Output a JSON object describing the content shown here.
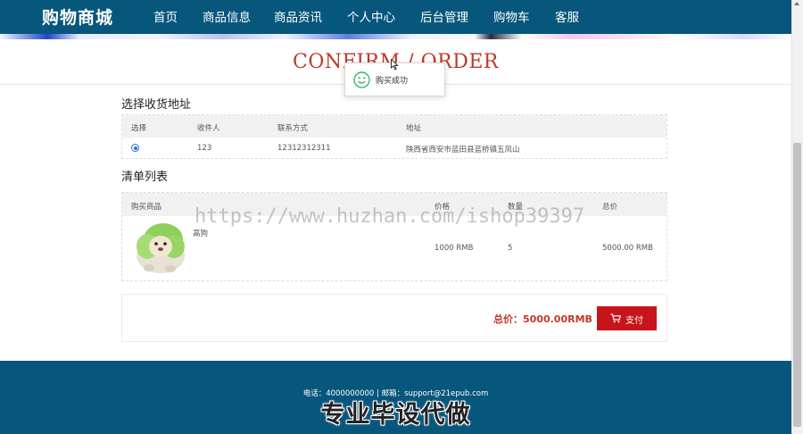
{
  "nav": {
    "brand": "购物商城",
    "items": [
      "首页",
      "商品信息",
      "商品资讯",
      "个人中心",
      "后台管理",
      "购物车",
      "客服"
    ]
  },
  "page": {
    "title": "CONFIRM / ORDER"
  },
  "toast": {
    "message": "购买成功"
  },
  "address_section": {
    "heading": "选择收货地址",
    "columns": [
      "选择",
      "收件人",
      "联系方式",
      "地址"
    ],
    "rows": [
      {
        "selected": true,
        "recipient": "123",
        "phone": "12312312311",
        "address": "陕西省西安市蓝田县蓝桥镇五凤山"
      }
    ]
  },
  "cart_section": {
    "heading": "清单列表",
    "columns": [
      "购买商品",
      "价格",
      "数量",
      "总价"
    ],
    "items": [
      {
        "name": "高狗",
        "price": "1000 RMB",
        "quantity": "5",
        "total": "5000.00 RMB",
        "image": "product-image"
      }
    ]
  },
  "summary": {
    "total_label": "总价：5000.00RMB",
    "pay_label": "支付"
  },
  "footer": {
    "info": "电话：4000000000 | 邮箱：support@21epub.com"
  },
  "overlays": {
    "watermark": "https://www.huzhan.com/ishop39397",
    "promo": "专业毕设代做"
  },
  "colors": {
    "nav_bg": "#07567c",
    "accent_red": "#c7141a",
    "title_red": "#c0392b",
    "success_green": "#3cb371"
  }
}
